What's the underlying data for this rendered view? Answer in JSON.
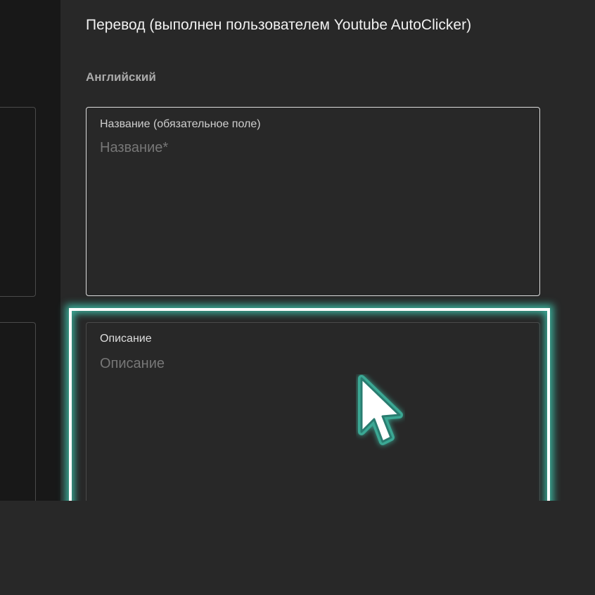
{
  "section": {
    "title": "Перевод (выполнен пользователем Youtube AutoClicker)",
    "language": "Английский"
  },
  "title_field": {
    "label": "Название (обязательное поле)",
    "placeholder": "Название*",
    "value": ""
  },
  "description_field": {
    "label": "Описание",
    "placeholder": "Описание",
    "value": ""
  },
  "colors": {
    "background": "#282828",
    "left_panel": "#181818",
    "highlight_glow": "#3aa894",
    "highlight_border": "#ffffff"
  },
  "icons": {
    "cursor": "mouse-pointer-icon"
  }
}
